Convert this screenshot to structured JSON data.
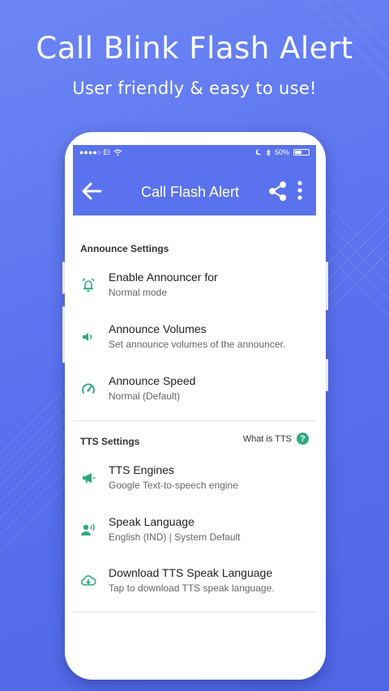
{
  "promo": {
    "title": "Call Blink Flash Alert",
    "subtitle": "User friendly & easy to use!"
  },
  "status_bar": {
    "carrier": "●●●●○ EI",
    "battery_text": "50%",
    "battery_level": 0.5
  },
  "toolbar": {
    "title": "Call Flash Alert",
    "back_icon": "arrow-left-icon",
    "share_icon": "share-icon",
    "more_icon": "more-vertical-icon"
  },
  "sections": {
    "announce": {
      "header": "Announce Settings",
      "items": [
        {
          "title": "Enable Announcer for",
          "subtitle": "Normal mode",
          "icon": "bell-ring-icon"
        },
        {
          "title": "Announce Volumes",
          "subtitle": "Set announce volumes of the announcer.",
          "icon": "volume-icon"
        },
        {
          "title": "Announce Speed",
          "subtitle": "Normal (Default)",
          "icon": "speedometer-icon"
        }
      ]
    },
    "tts": {
      "header": "TTS Settings",
      "what_is_tts": "What is TTS",
      "help_glyph": "?",
      "items": [
        {
          "title": "TTS Engines",
          "subtitle": "Google Text-to-speech engine",
          "icon": "megaphone-icon"
        },
        {
          "title": "Speak Language",
          "subtitle": "English (IND) | System Default",
          "icon": "speaking-person-icon"
        },
        {
          "title": "Download TTS Speak Language",
          "subtitle": "Tap to download TTS speak language.",
          "icon": "cloud-download-icon"
        }
      ]
    }
  },
  "colors": {
    "primary": "#5a72ee",
    "icon_green": "#2eaa7d"
  }
}
